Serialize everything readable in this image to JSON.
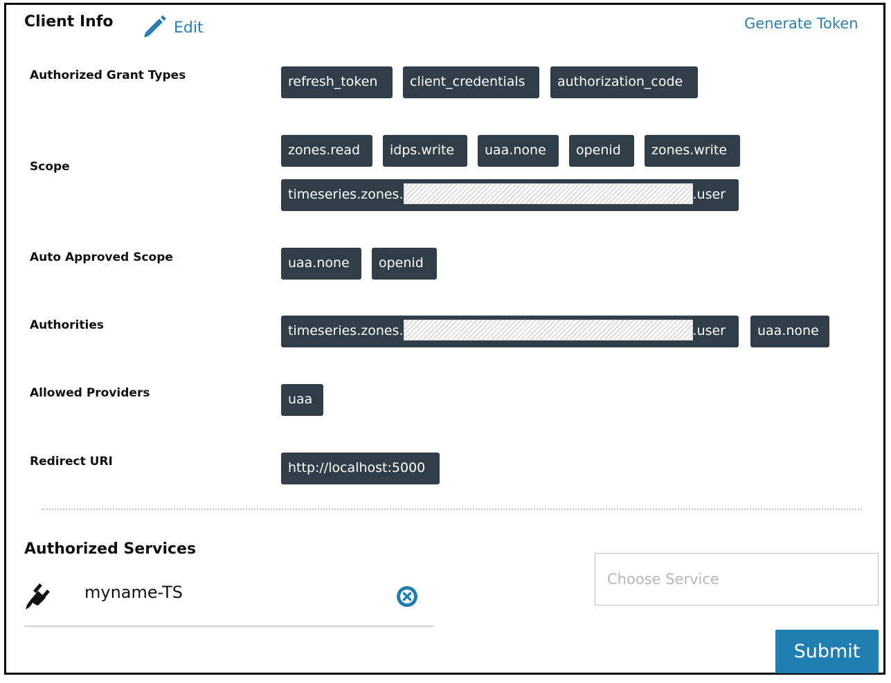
{
  "header": {
    "title": "Client Info",
    "edit_label": "Edit",
    "generate_label": "Generate Token"
  },
  "rows": {
    "grant_types": {
      "label": "Authorized Grant Types",
      "tags": [
        "refresh_token",
        "client_credentials",
        "authorization_code"
      ]
    },
    "scope": {
      "label": "Scope",
      "tags": [
        "zones.read",
        "idps.write",
        "uaa.none",
        "openid",
        "zones.write"
      ],
      "masked_tag": {
        "prefix": "timeseries.zones.",
        "suffix": ".user"
      }
    },
    "auto_approved": {
      "label": "Auto Approved Scope",
      "tags": [
        "uaa.none",
        "openid"
      ]
    },
    "authorities": {
      "label": "Authorities",
      "masked_tag": {
        "prefix": "timeseries.zones.",
        "suffix": ".user"
      },
      "tags": [
        "uaa.none"
      ]
    },
    "providers": {
      "label": "Allowed Providers",
      "tags": [
        "uaa"
      ]
    },
    "redirect": {
      "label": "Redirect URI",
      "tags": [
        "http://localhost:5000"
      ]
    }
  },
  "services": {
    "title": "Authorized Services",
    "items": [
      {
        "name": "myname-TS",
        "icon": "plug-icon"
      }
    ],
    "choose_placeholder": "Choose Service",
    "submit_label": "Submit"
  },
  "colors": {
    "tag_bg": "#2f3e49",
    "link": "#2a7fb0",
    "submit_bg": "#1f7fb2"
  }
}
